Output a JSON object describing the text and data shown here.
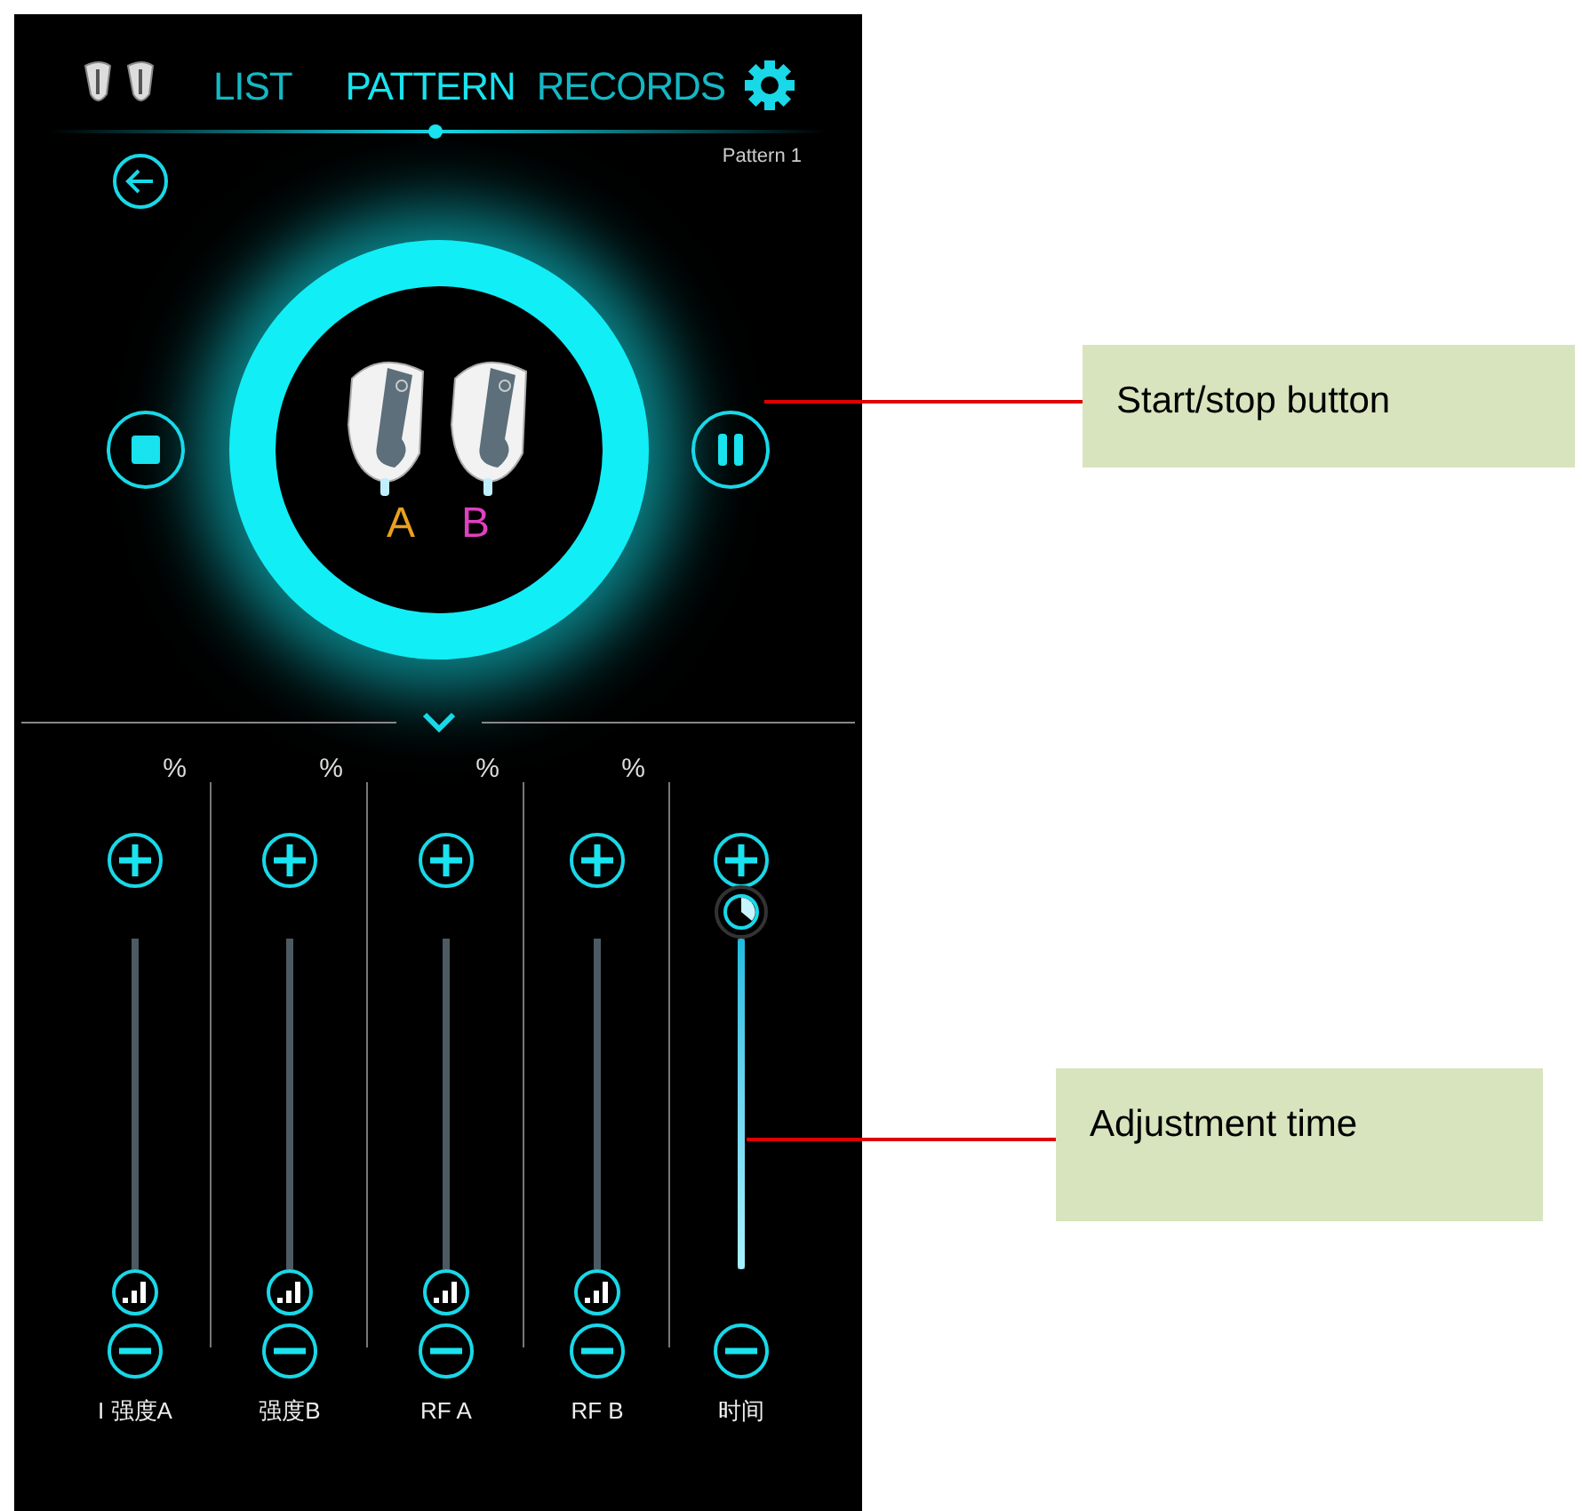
{
  "tabs": [
    {
      "label": "LIST",
      "selected": false
    },
    {
      "label": "PATTERN",
      "selected": true
    },
    {
      "label": "RECORDS",
      "selected": false
    }
  ],
  "pattern_name": "Pattern 1",
  "channels": [
    {
      "label": "A",
      "color": "#e8a020"
    },
    {
      "label": "B",
      "color": "#e040c0"
    }
  ],
  "sliders": [
    {
      "kind": "intensity",
      "unit": "%",
      "label": "I 强度A",
      "level": 0
    },
    {
      "kind": "intensity",
      "unit": "%",
      "label": "强度B",
      "level": 0
    },
    {
      "kind": "intensity",
      "unit": "%",
      "label": "RF A",
      "level": 0
    },
    {
      "kind": "intensity",
      "unit": "%",
      "label": "RF B",
      "level": 0
    },
    {
      "kind": "time",
      "label": "时间",
      "level": 1
    }
  ],
  "callouts": [
    {
      "text": "Start/stop button"
    },
    {
      "text": "Adjustment time"
    }
  ]
}
